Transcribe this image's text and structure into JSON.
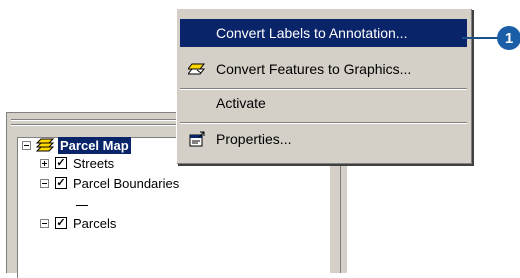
{
  "menu": {
    "items": [
      {
        "label": "Convert Labels to Annotation...",
        "highlighted": true,
        "icon": null
      },
      {
        "label": "Convert Features to Graphics...",
        "highlighted": false,
        "icon": "convert-features-icon"
      },
      {
        "label": "Activate",
        "highlighted": false,
        "icon": null
      },
      {
        "label": "Properties...",
        "highlighted": false,
        "icon": "properties-icon"
      }
    ]
  },
  "toc": {
    "data_frame": {
      "label": "Parcel Map",
      "expanded": true,
      "selected": true,
      "icon": "layers-icon"
    },
    "layers": [
      {
        "label": "Streets",
        "checked": true,
        "expanded": false
      },
      {
        "label": "Parcel Boundaries",
        "checked": true,
        "expanded": true
      },
      {
        "label": "Parcels",
        "checked": true,
        "expanded": true
      }
    ]
  },
  "callout": {
    "number": "1"
  },
  "colors": {
    "highlight": "#0a246a",
    "callout": "#1a5ea8",
    "chrome": "#d4d0c8"
  }
}
